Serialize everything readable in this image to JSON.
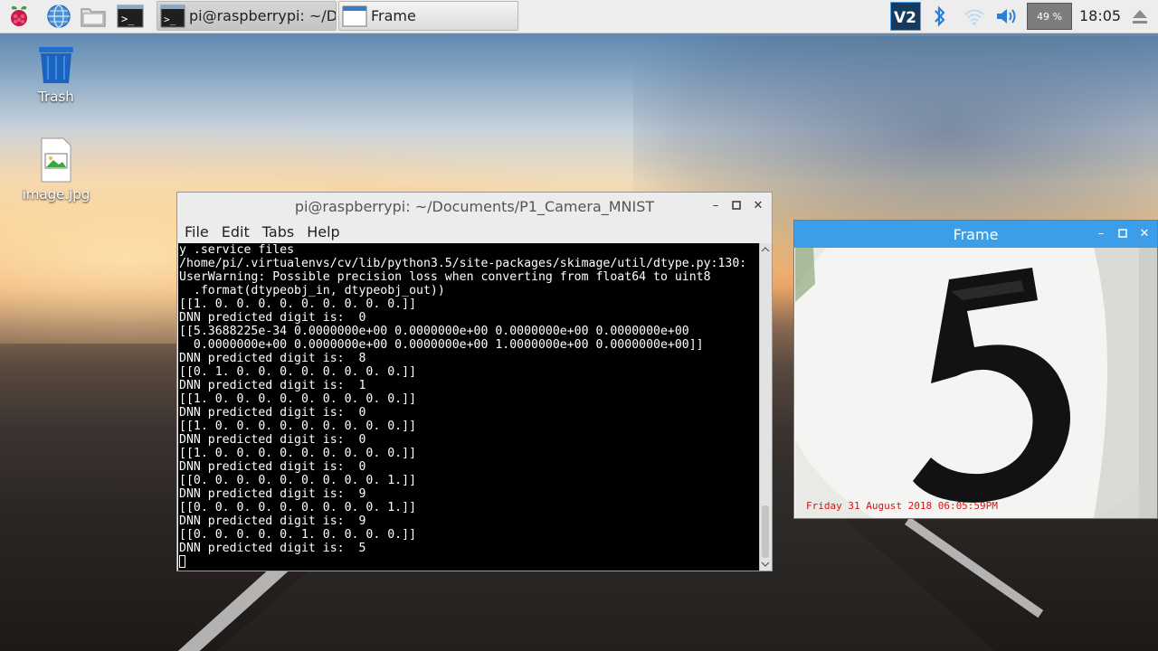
{
  "taskbar": {
    "tasks": [
      {
        "label": "pi@raspberrypi: ~/Do..."
      },
      {
        "label": "Frame"
      }
    ],
    "cpu_label": "49 %",
    "clock": "18:05"
  },
  "desktop": {
    "icons": [
      {
        "label": "Trash"
      },
      {
        "label": "image.jpg"
      }
    ]
  },
  "terminal": {
    "title": "pi@raspberrypi: ~/Documents/P1_Camera_MNIST",
    "menu": [
      "File",
      "Edit",
      "Tabs",
      "Help"
    ],
    "lines": [
      "y .service files",
      "/home/pi/.virtualenvs/cv/lib/python3.5/site-packages/skimage/util/dtype.py:130:",
      "UserWarning: Possible precision loss when converting from float64 to uint8",
      "  .format(dtypeobj_in, dtypeobj_out))",
      "[[1. 0. 0. 0. 0. 0. 0. 0. 0. 0.]]",
      "DNN predicted digit is:  0",
      "[[5.3688225e-34 0.0000000e+00 0.0000000e+00 0.0000000e+00 0.0000000e+00",
      "  0.0000000e+00 0.0000000e+00 0.0000000e+00 1.0000000e+00 0.0000000e+00]]",
      "DNN predicted digit is:  8",
      "[[0. 1. 0. 0. 0. 0. 0. 0. 0. 0.]]",
      "DNN predicted digit is:  1",
      "[[1. 0. 0. 0. 0. 0. 0. 0. 0. 0.]]",
      "DNN predicted digit is:  0",
      "[[1. 0. 0. 0. 0. 0. 0. 0. 0. 0.]]",
      "DNN predicted digit is:  0",
      "[[1. 0. 0. 0. 0. 0. 0. 0. 0. 0.]]",
      "DNN predicted digit is:  0",
      "[[0. 0. 0. 0. 0. 0. 0. 0. 0. 1.]]",
      "DNN predicted digit is:  9",
      "[[0. 0. 0. 0. 0. 0. 0. 0. 0. 1.]]",
      "DNN predicted digit is:  9",
      "[[0. 0. 0. 0. 0. 1. 0. 0. 0. 0.]]",
      "DNN predicted digit is:  5"
    ]
  },
  "frame_window": {
    "title": "Frame",
    "timestamp": "Friday 31 August 2018 06:05:59PM"
  }
}
